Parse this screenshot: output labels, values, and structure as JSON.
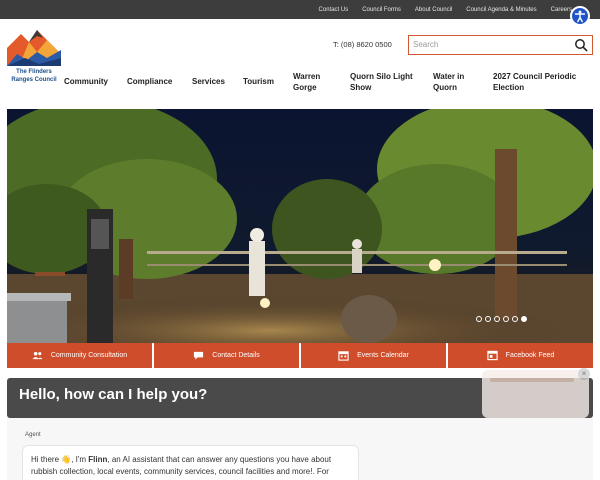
{
  "utility_links": [
    "Contact Us",
    "Council Forms",
    "About Council",
    "Council Agenda & Minutes",
    "Careers"
  ],
  "logo": {
    "line1": "The Flinders",
    "line2": "Ranges Council"
  },
  "phone": "T: (08) 8620 0500",
  "search": {
    "placeholder": "Search"
  },
  "nav": [
    {
      "label": "Community"
    },
    {
      "label": "Compliance"
    },
    {
      "label": "Services"
    },
    {
      "label": "Tourism"
    },
    {
      "label": "Warren Gorge"
    },
    {
      "label": "Quorn Silo Light Show"
    },
    {
      "label": "Water in Quorn"
    },
    {
      "label": "2027 Council Periodic Election"
    }
  ],
  "slider": {
    "total": 6,
    "active": 6
  },
  "quick_links": [
    {
      "label": "Community Consultation",
      "icon": "people-icon"
    },
    {
      "label": "Contact Details",
      "icon": "chat-bubble-icon"
    },
    {
      "label": "Events Calendar",
      "icon": "calendar-icon"
    },
    {
      "label": "Facebook Feed",
      "icon": "feed-icon"
    }
  ],
  "chat": {
    "heading": "Hello, how can I help you?",
    "agent_label": "Agent",
    "greeting_pre": "Hi there 👋, I'm ",
    "name": "Flinn",
    "greeting_post": ", an AI assistant that can answer any questions you have about rubbish collection, local events, community services, council facilities and more!. For"
  },
  "colors": {
    "accent": "#cf4d2a",
    "topbar": "#3d3d3d",
    "chat_header": "#4a4a4a",
    "link_blue": "#1d4f8c",
    "accessibility_blue": "#1f55c6"
  }
}
